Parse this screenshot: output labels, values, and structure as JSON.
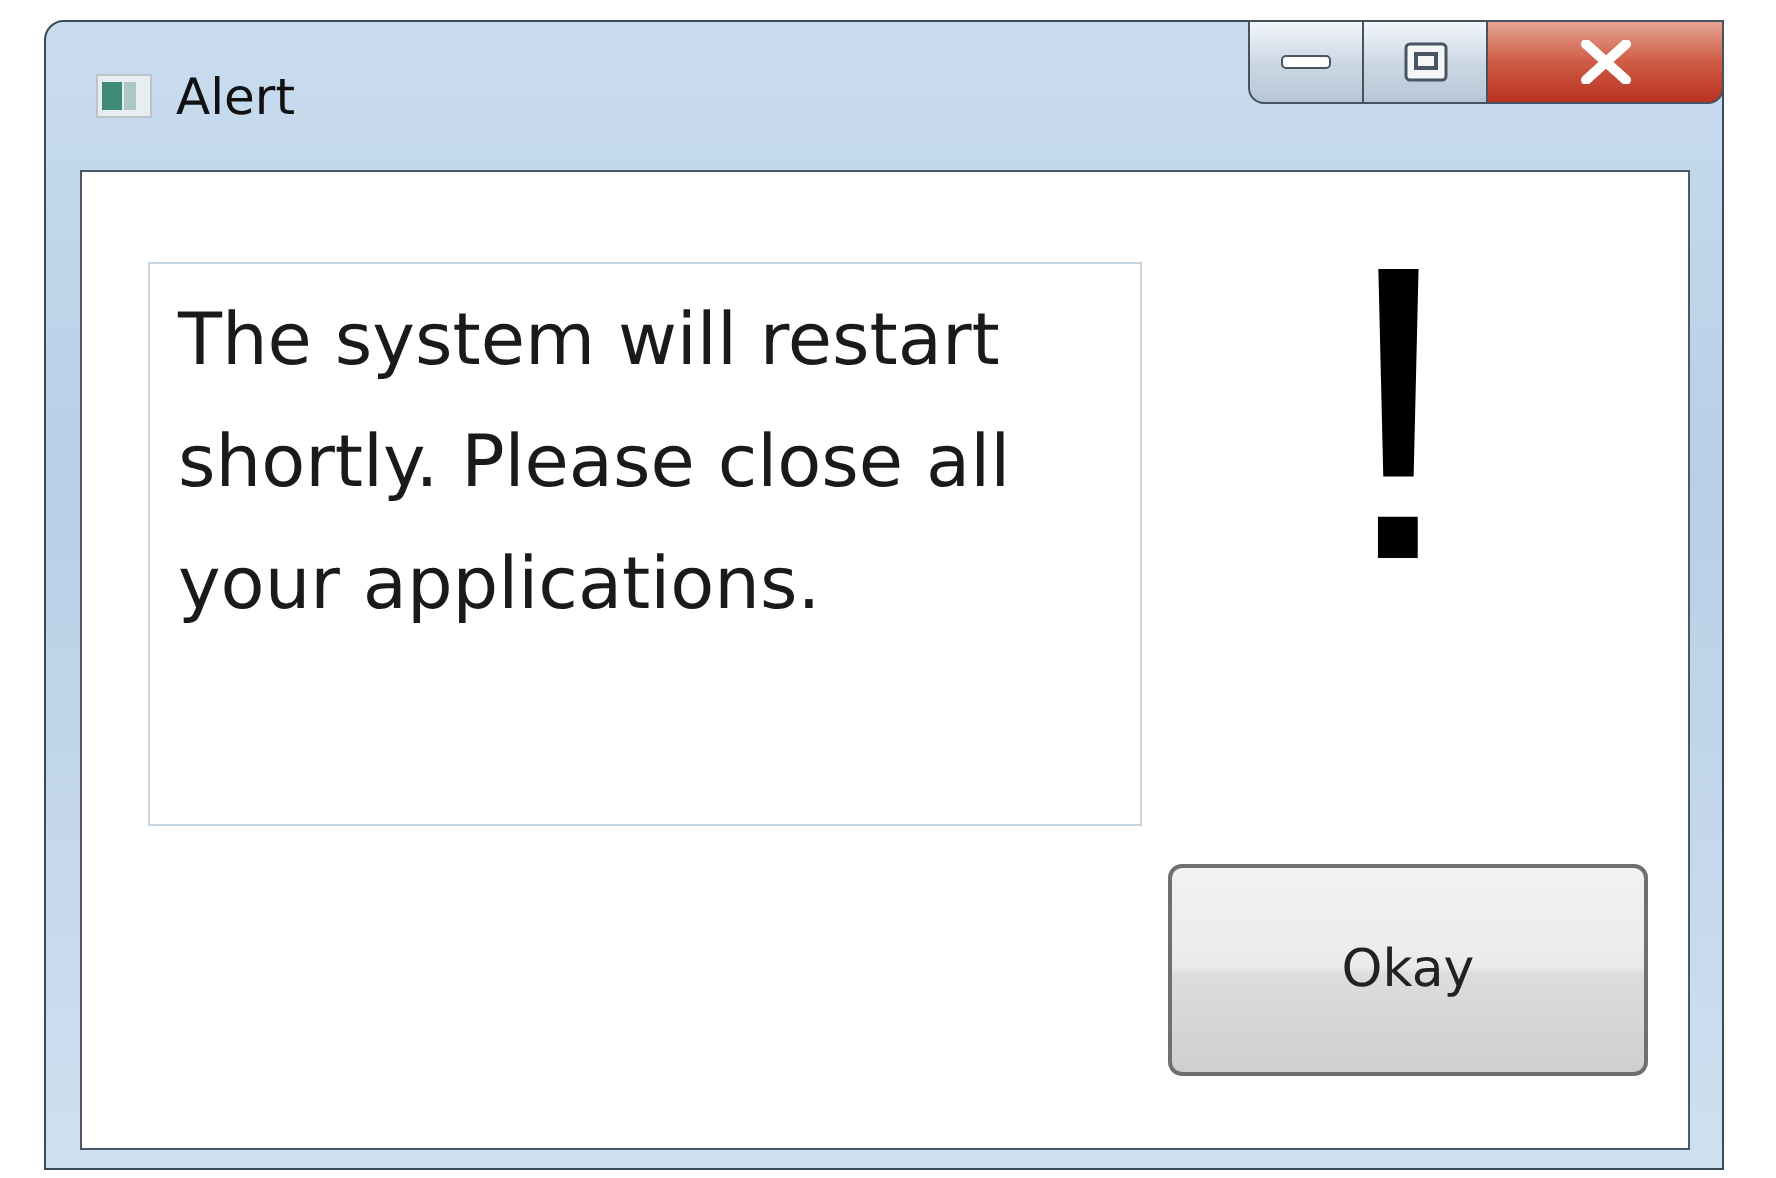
{
  "window": {
    "title": "Alert"
  },
  "message": {
    "value": "The system will restart shortly. Please close all your applications."
  },
  "alert_glyph": "!",
  "buttons": [
    {
      "label": "Okay"
    }
  ]
}
